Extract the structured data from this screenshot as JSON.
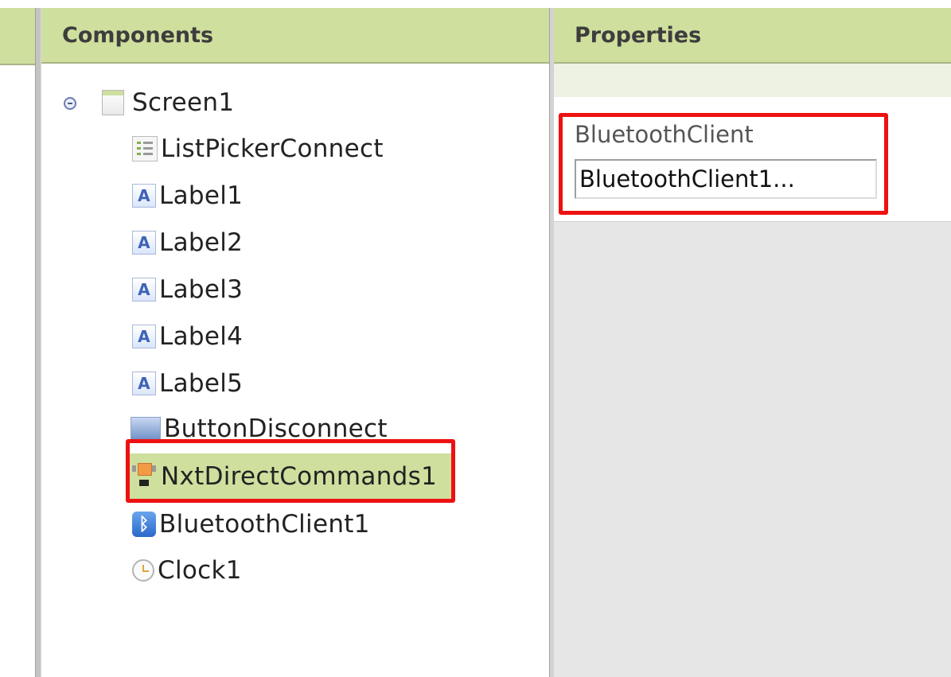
{
  "components_panel": {
    "title": "Components",
    "tree": [
      {
        "label": "Screen1",
        "icon": "screen-icon"
      },
      {
        "label": "ListPickerConnect",
        "icon": "listpicker-icon"
      },
      {
        "label": "Label1",
        "icon": "label-icon"
      },
      {
        "label": "Label2",
        "icon": "label-icon"
      },
      {
        "label": "Label3",
        "icon": "label-icon"
      },
      {
        "label": "Label4",
        "icon": "label-icon"
      },
      {
        "label": "Label5",
        "icon": "label-icon"
      },
      {
        "label": "ButtonDisconnect",
        "icon": "button-icon"
      },
      {
        "label": "NxtDirectCommands1",
        "icon": "nxt-direct-commands-icon",
        "selected": true
      },
      {
        "label": "BluetoothClient1",
        "icon": "bluetooth-icon"
      },
      {
        "label": "Clock1",
        "icon": "clock-icon"
      }
    ],
    "label_icon_glyph": "A",
    "bluetooth_glyph": "ᛒ"
  },
  "properties_panel": {
    "title": "Properties",
    "property_name": "BluetoothClient",
    "property_value": "BluetoothClient1..."
  },
  "colors": {
    "header_green": "#cfdf9e",
    "selection_green": "#cfdf9e",
    "highlight_red": "#ee1111"
  }
}
